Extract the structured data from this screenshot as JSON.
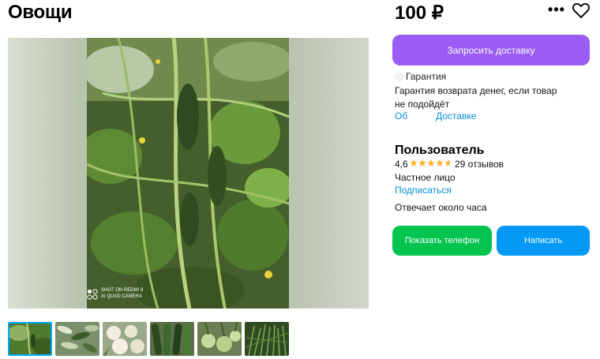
{
  "listing": {
    "title": "Овощи",
    "price": "100 ₽"
  },
  "gallery": {
    "watermark_line1": "SHOT ON REDMI 9",
    "watermark_line2": "AI QUAD CAMERA",
    "thumbnails": [
      "cucumber-plants",
      "pile-of-cucumbers",
      "cauliflower",
      "zucchini",
      "kohlrabi",
      "dill-greens"
    ]
  },
  "actions": {
    "request_delivery": "Запросить доставку",
    "show_phone": "Показать телефон",
    "write": "Написать"
  },
  "guarantee": {
    "title": "Гарантия",
    "text": "Гарантия возврата денег, если товар не подойдёт",
    "link_more": "Об",
    "link_delivery": "Доставке"
  },
  "seller": {
    "name": "Пользователь",
    "rating": "4,6",
    "stars": 4.6,
    "reviews": "29 отзывов",
    "type": "Частное лицо",
    "subscribe": "Подписаться",
    "response_time": "Отвечает около часа"
  },
  "colors": {
    "delivery_button": "#9a5cf2",
    "phone_button": "#02c44f",
    "write_button": "#0399f5",
    "link": "#0a8fd8",
    "star": "#ffb021"
  },
  "icons": {
    "more": "more-dots-icon",
    "favorite": "heart-icon",
    "guarantee": "shield-icon",
    "star": "star-icon"
  }
}
